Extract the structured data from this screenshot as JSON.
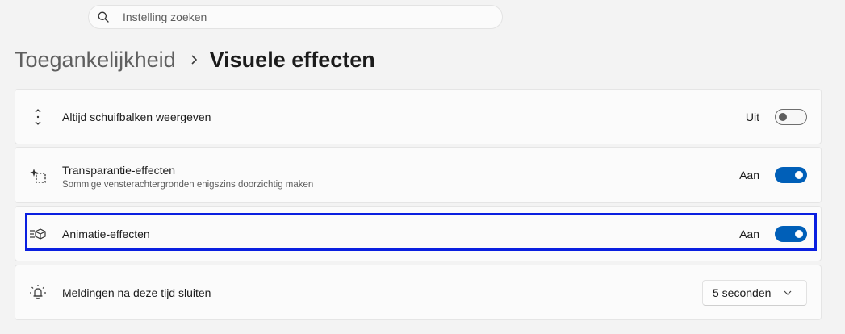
{
  "search": {
    "placeholder": "Instelling zoeken"
  },
  "breadcrumb": {
    "parent": "Toegankelijkheid",
    "current": "Visuele effecten"
  },
  "settings": [
    {
      "title": "Altijd schuifbalken weergeven",
      "state": "Uit",
      "icon": "scrollbar-icon"
    },
    {
      "title": "Transparantie-effecten",
      "description": "Sommige vensterachtergronden enigszins doorzichtig maken",
      "state": "Aan",
      "icon": "transparency-icon"
    },
    {
      "title": "Animatie-effecten",
      "state": "Aan",
      "icon": "animation-icon"
    },
    {
      "title": "Meldingen na deze tijd sluiten",
      "dropdown_value": "5 seconden",
      "icon": "notification-bell-icon"
    }
  ],
  "colors": {
    "accent": "#005fb8",
    "highlight": "#0a1fe0",
    "background": "#f3f3f3"
  }
}
